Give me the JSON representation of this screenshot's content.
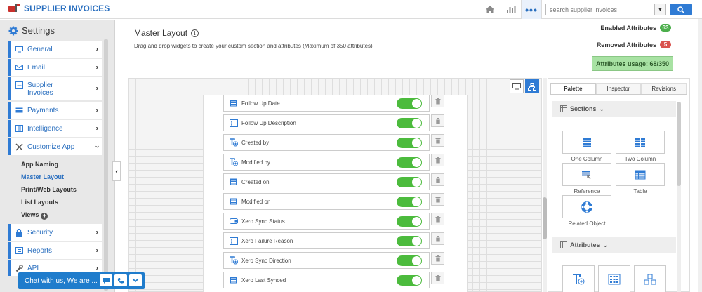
{
  "app": {
    "title": "SUPPLIER INVOICES"
  },
  "topbar": {
    "more_label": "•••",
    "search": {
      "placeholder": "search supplier invoices"
    }
  },
  "sidebar": {
    "heading": "Settings",
    "items": [
      {
        "label": "General"
      },
      {
        "label": "Email"
      },
      {
        "label": "Supplier Invoices"
      },
      {
        "label": "Payments"
      },
      {
        "label": "Intelligence"
      },
      {
        "label": "Customize App"
      },
      {
        "label": "Security"
      },
      {
        "label": "Reports"
      },
      {
        "label": "API"
      }
    ],
    "subitems": [
      {
        "label": "App Naming"
      },
      {
        "label": "Master Layout"
      },
      {
        "label": "Print/Web Layouts"
      },
      {
        "label": "List Layouts"
      },
      {
        "label": "Views"
      }
    ]
  },
  "main": {
    "title": "Master Layout",
    "description": "Drag and drop widgets to create your custom section and attributes (Maximum of 350 attributes)",
    "enabled_label": "Enabled Attributes",
    "enabled_count": "63",
    "removed_label": "Removed Attributes",
    "removed_count": "5",
    "usage": "Attributes usage: 68/350"
  },
  "fields": [
    {
      "label": "Follow Up Date",
      "icon": "date-field-icon",
      "enabled": true
    },
    {
      "label": "Follow Up Description",
      "icon": "textarea-field-icon",
      "enabled": true
    },
    {
      "label": "Created by",
      "icon": "user-field-icon",
      "enabled": true
    },
    {
      "label": "Modified by",
      "icon": "user-field-icon",
      "enabled": true
    },
    {
      "label": "Created on",
      "icon": "date-field-icon",
      "enabled": true
    },
    {
      "label": "Modified on",
      "icon": "date-field-icon",
      "enabled": true
    },
    {
      "label": "Xero Sync Status",
      "icon": "dropdown-field-icon",
      "enabled": true
    },
    {
      "label": "Xero Failure Reason",
      "icon": "textarea-field-icon",
      "enabled": true
    },
    {
      "label": "Xero Sync Direction",
      "icon": "user-field-icon",
      "enabled": true
    },
    {
      "label": "Xero Last Synced",
      "icon": "date-field-icon",
      "enabled": true
    }
  ],
  "palette": {
    "tabs": [
      "Palette",
      "Inspector",
      "Revisions"
    ],
    "sections_heading": "Sections",
    "sections": [
      {
        "label": "One Column"
      },
      {
        "label": "Two Column"
      },
      {
        "label": "Reference"
      },
      {
        "label": "Table"
      },
      {
        "label": "Related Object"
      }
    ],
    "attributes_heading": "Attributes"
  },
  "chat": {
    "label": "Chat with us, We are ..."
  },
  "colors": {
    "accent": "#2f7bd4",
    "toggle_on": "#4cbb3d",
    "badge_green": "#4cae4c",
    "badge_red": "#d9534f",
    "usage_bg": "#a8e2a3"
  }
}
